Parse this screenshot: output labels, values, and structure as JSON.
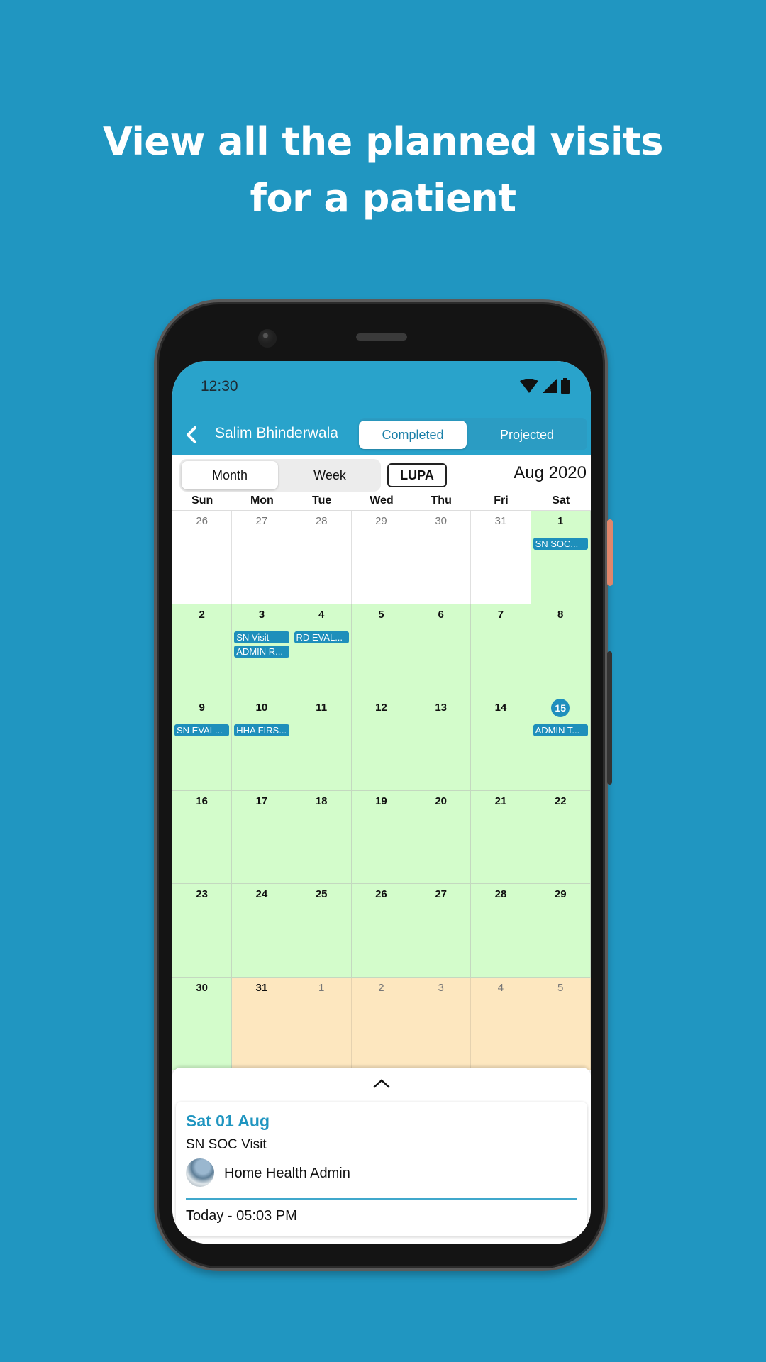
{
  "headline": {
    "line1": "View all the planned visits",
    "line2": "for a patient"
  },
  "status_bar": {
    "time": "12:30",
    "icons": [
      "wifi-icon",
      "signal-icon",
      "battery-icon"
    ]
  },
  "app_bar": {
    "back_icon": "chevron-left-icon",
    "patient_name": "Salim Bhinderwala",
    "tabs": [
      {
        "label": "Completed",
        "selected": true
      },
      {
        "label": "Projected",
        "selected": false
      }
    ]
  },
  "toolbar": {
    "view_options": [
      {
        "label": "Month",
        "selected": true
      },
      {
        "label": "Week",
        "selected": false
      }
    ],
    "lupa_label": "LUPA",
    "month_label": "Aug 2020"
  },
  "calendar": {
    "weekdays": [
      "Sun",
      "Mon",
      "Tue",
      "Wed",
      "Thu",
      "Fri",
      "Sat"
    ],
    "weeks": [
      [
        {
          "day": "26",
          "state": "prev-month",
          "events": []
        },
        {
          "day": "27",
          "state": "prev-month",
          "events": []
        },
        {
          "day": "28",
          "state": "prev-month",
          "events": []
        },
        {
          "day": "29",
          "state": "prev-month",
          "events": []
        },
        {
          "day": "30",
          "state": "prev-month",
          "events": []
        },
        {
          "day": "31",
          "state": "prev-month",
          "events": []
        },
        {
          "day": "1",
          "state": "in",
          "events": [
            "SN SOC..."
          ]
        }
      ],
      [
        {
          "day": "2",
          "state": "in",
          "events": []
        },
        {
          "day": "3",
          "state": "in",
          "events": [
            "SN Visit",
            "ADMIN R..."
          ]
        },
        {
          "day": "4",
          "state": "in",
          "events": [
            "RD EVAL..."
          ]
        },
        {
          "day": "5",
          "state": "in",
          "events": []
        },
        {
          "day": "6",
          "state": "in",
          "events": []
        },
        {
          "day": "7",
          "state": "in",
          "events": []
        },
        {
          "day": "8",
          "state": "in",
          "events": []
        }
      ],
      [
        {
          "day": "9",
          "state": "in",
          "events": [
            "SN EVAL..."
          ]
        },
        {
          "day": "10",
          "state": "in",
          "events": [
            "HHA FIRS..."
          ]
        },
        {
          "day": "11",
          "state": "in",
          "events": []
        },
        {
          "day": "12",
          "state": "in",
          "events": []
        },
        {
          "day": "13",
          "state": "in",
          "events": []
        },
        {
          "day": "14",
          "state": "in",
          "events": []
        },
        {
          "day": "15",
          "state": "in",
          "today": true,
          "events": [
            "ADMIN T..."
          ]
        }
      ],
      [
        {
          "day": "16",
          "state": "in",
          "events": []
        },
        {
          "day": "17",
          "state": "in",
          "events": []
        },
        {
          "day": "18",
          "state": "in",
          "events": []
        },
        {
          "day": "19",
          "state": "in",
          "events": []
        },
        {
          "day": "20",
          "state": "in",
          "events": []
        },
        {
          "day": "21",
          "state": "in",
          "events": []
        },
        {
          "day": "22",
          "state": "in",
          "events": []
        }
      ],
      [
        {
          "day": "23",
          "state": "in",
          "events": []
        },
        {
          "day": "24",
          "state": "in",
          "events": []
        },
        {
          "day": "25",
          "state": "in",
          "events": []
        },
        {
          "day": "26",
          "state": "in",
          "events": []
        },
        {
          "day": "27",
          "state": "in",
          "events": []
        },
        {
          "day": "28",
          "state": "in",
          "events": []
        },
        {
          "day": "29",
          "state": "in",
          "events": []
        }
      ],
      [
        {
          "day": "30",
          "state": "in",
          "events": []
        },
        {
          "day": "31",
          "state": "future",
          "events": []
        },
        {
          "day": "1",
          "state": "next-month",
          "events": []
        },
        {
          "day": "2",
          "state": "next-month",
          "events": []
        },
        {
          "day": "3",
          "state": "next-month",
          "events": []
        },
        {
          "day": "4",
          "state": "next-month",
          "events": []
        },
        {
          "day": "5",
          "state": "next-month",
          "events": []
        }
      ]
    ]
  },
  "visit_card": {
    "expand_icon": "chevron-up-icon",
    "date": "Sat 01 Aug",
    "visit_type": "SN SOC Visit",
    "user_name": "Home Health Admin",
    "time": "Today - 05:03 PM"
  },
  "colors": {
    "background": "#2096c1",
    "app_bar": "#29a3cb",
    "accent": "#1f95c0",
    "completed_cell": "#d3fccb",
    "projected_cell": "#fde7bf",
    "event_chip": "#1e8fbb"
  }
}
